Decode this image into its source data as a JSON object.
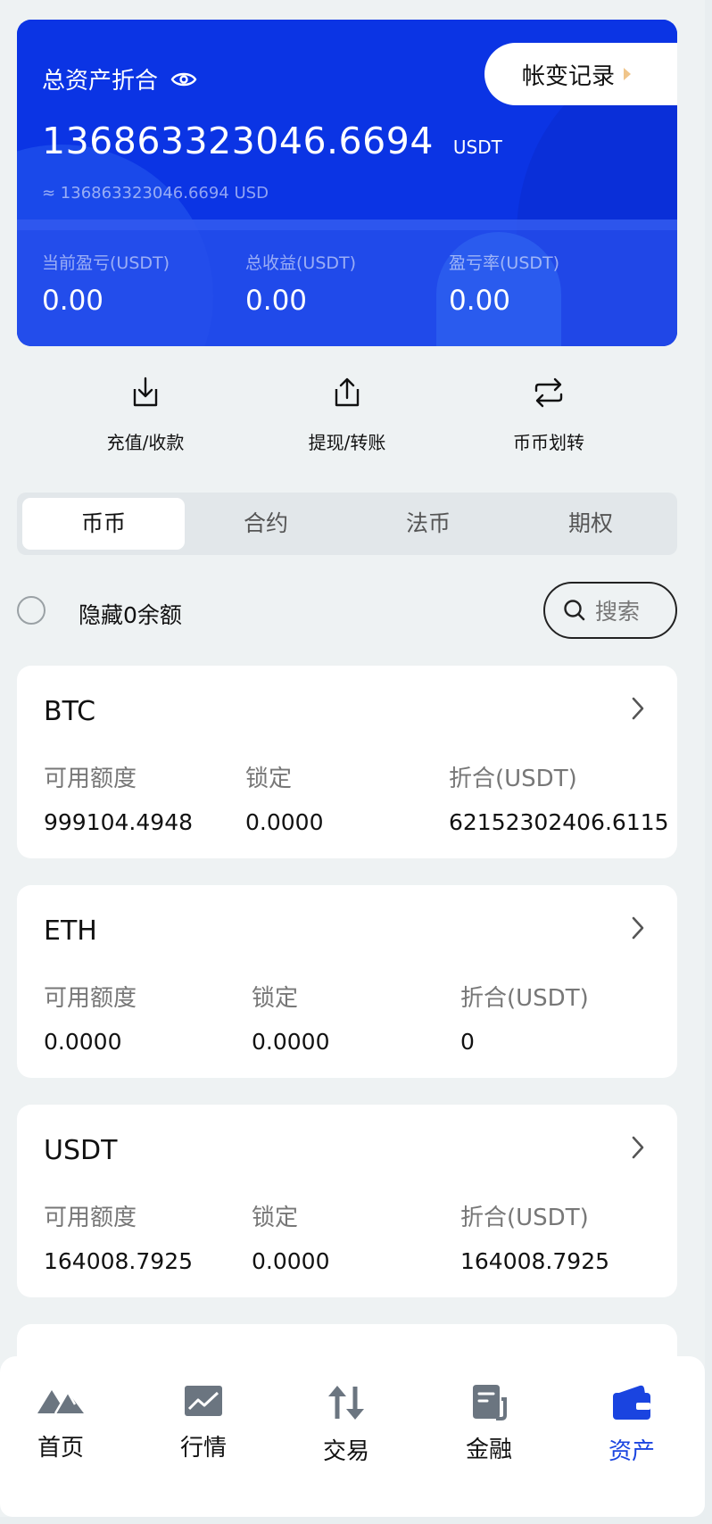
{
  "header": {
    "title": "总资产折合",
    "history_label": "帐变记录",
    "total_value": "136863323046.6694",
    "total_unit": "USDT",
    "approx_value": "≈ 136863323046.6694 USD",
    "stats": [
      {
        "label": "当前盈亏(USDT)",
        "value": "0.00"
      },
      {
        "label": "总收益(USDT)",
        "value": "0.00"
      },
      {
        "label": "盈亏率(USDT)",
        "value": "0.00"
      }
    ]
  },
  "actions": [
    {
      "label": "充值/收款",
      "icon": "download-icon"
    },
    {
      "label": "提现/转账",
      "icon": "upload-icon"
    },
    {
      "label": "币币划转",
      "icon": "transfer-icon"
    }
  ],
  "tabs": [
    {
      "label": "币币",
      "active": true
    },
    {
      "label": "合约",
      "active": false
    },
    {
      "label": "法币",
      "active": false
    },
    {
      "label": "期权",
      "active": false
    }
  ],
  "filter": {
    "hide_zero_label": "隐藏0余额",
    "search_placeholder": "搜索"
  },
  "assets": [
    {
      "symbol": "BTC",
      "available_label": "可用额度",
      "available": "999104.4948",
      "locked_label": "锁定",
      "locked": "0.0000",
      "value_label": "折合(USDT)",
      "value": "62152302406.6115"
    },
    {
      "symbol": "ETH",
      "available_label": "可用额度",
      "available": "0.0000",
      "locked_label": "锁定",
      "locked": "0.0000",
      "value_label": "折合(USDT)",
      "value": "0"
    },
    {
      "symbol": "USDT",
      "available_label": "可用额度",
      "available": "164008.7925",
      "locked_label": "锁定",
      "locked": "0.0000",
      "value_label": "折合(USDT)",
      "value": "164008.7925"
    }
  ],
  "nav": [
    {
      "label": "首页",
      "icon": "home-mountain-icon"
    },
    {
      "label": "行情",
      "icon": "market-chart-icon"
    },
    {
      "label": "交易",
      "icon": "trade-arrows-icon"
    },
    {
      "label": "金融",
      "icon": "finance-doc-icon"
    },
    {
      "label": "资产",
      "icon": "wallet-icon",
      "active": true
    }
  ],
  "colors": {
    "brand_blue": "#0b34e4",
    "active_nav": "#1a44e0",
    "icon_gray": "#6b7580"
  }
}
